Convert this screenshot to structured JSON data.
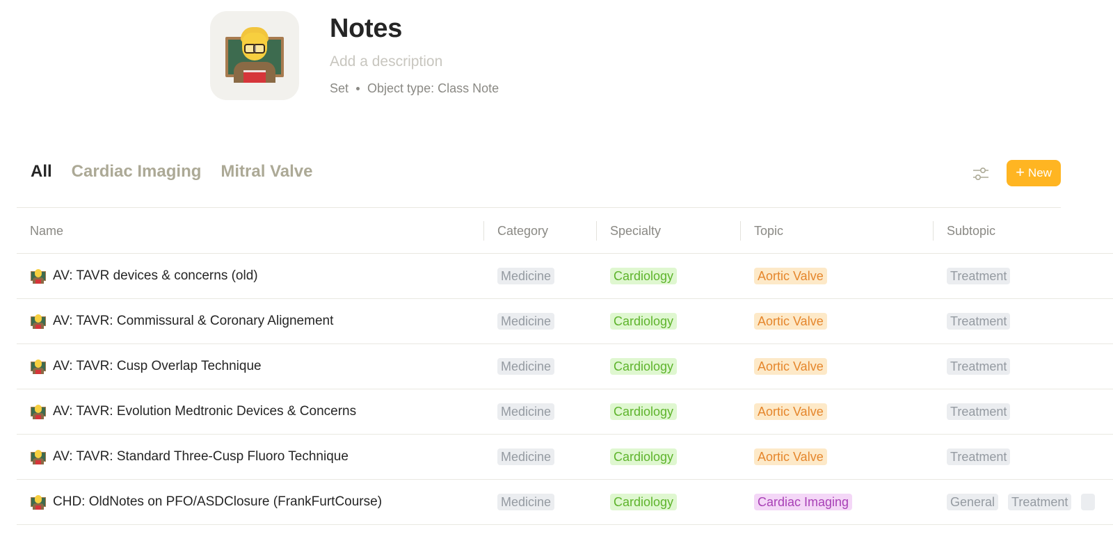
{
  "set": {
    "icon": "teacher-emoji-icon",
    "title": "Notes",
    "description_placeholder": "Add a description",
    "kind": "Set",
    "object_type": "Object type: Class Note"
  },
  "views": [
    {
      "label": "All",
      "active": true
    },
    {
      "label": "Cardiac Imaging",
      "active": false
    },
    {
      "label": "Mitral Valve",
      "active": false
    }
  ],
  "toolbar": {
    "settings_icon": "sliders-icon",
    "new_label": "New",
    "new_icon": "plus-icon",
    "accent_color": "#ffb522"
  },
  "table": {
    "columns": [
      "Name",
      "Category",
      "Specialty",
      "Topic",
      "Subtopic"
    ],
    "rows": [
      {
        "name": "AV: TAVR devices & concerns (old)",
        "category": [
          {
            "label": "Medicine",
            "color": "gray"
          }
        ],
        "specialty": [
          {
            "label": "Cardiology",
            "color": "green"
          }
        ],
        "topic": [
          {
            "label": "Aortic Valve",
            "color": "orange"
          }
        ],
        "subtopic": [
          {
            "label": "Treatment",
            "color": "gray"
          }
        ]
      },
      {
        "name": "AV: TAVR: Commissural & Coronary Alignement",
        "category": [
          {
            "label": "Medicine",
            "color": "gray"
          }
        ],
        "specialty": [
          {
            "label": "Cardiology",
            "color": "green"
          }
        ],
        "topic": [
          {
            "label": "Aortic Valve",
            "color": "orange"
          }
        ],
        "subtopic": [
          {
            "label": "Treatment",
            "color": "gray"
          }
        ]
      },
      {
        "name": "AV: TAVR: Cusp Overlap Technique",
        "category": [
          {
            "label": "Medicine",
            "color": "gray"
          }
        ],
        "specialty": [
          {
            "label": "Cardiology",
            "color": "green"
          }
        ],
        "topic": [
          {
            "label": "Aortic Valve",
            "color": "orange"
          }
        ],
        "subtopic": [
          {
            "label": "Treatment",
            "color": "gray"
          }
        ]
      },
      {
        "name": "AV: TAVR: Evolution Medtronic Devices & Concerns",
        "category": [
          {
            "label": "Medicine",
            "color": "gray"
          }
        ],
        "specialty": [
          {
            "label": "Cardiology",
            "color": "green"
          }
        ],
        "topic": [
          {
            "label": "Aortic Valve",
            "color": "orange"
          }
        ],
        "subtopic": [
          {
            "label": "Treatment",
            "color": "gray"
          }
        ]
      },
      {
        "name": "AV: TAVR: Standard Three-Cusp Fluoro Technique",
        "category": [
          {
            "label": "Medicine",
            "color": "gray"
          }
        ],
        "specialty": [
          {
            "label": "Cardiology",
            "color": "green"
          }
        ],
        "topic": [
          {
            "label": "Aortic Valve",
            "color": "orange"
          }
        ],
        "subtopic": [
          {
            "label": "Treatment",
            "color": "gray"
          }
        ]
      },
      {
        "name": "CHD: OldNotes on PFO/ASDClosure (FrankFurtCourse)",
        "category": [
          {
            "label": "Medicine",
            "color": "gray"
          }
        ],
        "specialty": [
          {
            "label": "Cardiology",
            "color": "green"
          }
        ],
        "topic": [
          {
            "label": "Cardiac Imaging",
            "color": "purple"
          }
        ],
        "subtopic": [
          {
            "label": "General",
            "color": "gray"
          },
          {
            "label": "Treatment",
            "color": "gray"
          },
          {
            "label": "",
            "color": "gray"
          }
        ]
      }
    ]
  }
}
